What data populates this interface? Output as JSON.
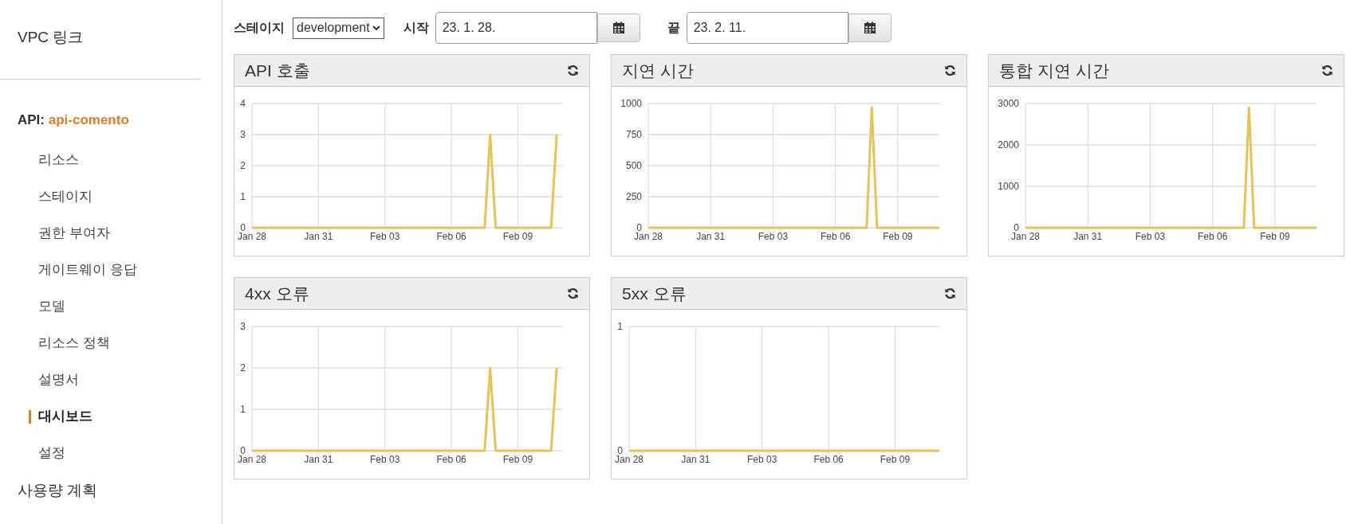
{
  "sidebar": {
    "top_link": "VPC 링크",
    "api_label": "API:",
    "api_name": "api-comento",
    "items": [
      {
        "label": "리소스",
        "selected": false
      },
      {
        "label": "스테이지",
        "selected": false
      },
      {
        "label": "권한 부여자",
        "selected": false
      },
      {
        "label": "게이트웨이 응답",
        "selected": false
      },
      {
        "label": "모델",
        "selected": false
      },
      {
        "label": "리소스 정책",
        "selected": false
      },
      {
        "label": "설명서",
        "selected": false
      },
      {
        "label": "대시보드",
        "selected": true
      },
      {
        "label": "설정",
        "selected": false
      }
    ],
    "bottom_link": "사용량 계획"
  },
  "controls": {
    "stage_label": "스테이지",
    "stage_value": "development",
    "start_label": "시작",
    "start_value": "23. 1. 28.",
    "end_label": "끝",
    "end_value": "23. 2. 11."
  },
  "panels": [
    {
      "title": "API 호출",
      "chart_data": {
        "type": "line",
        "grid": true,
        "ylim": [
          0,
          4
        ],
        "yticks": [
          0,
          1,
          2,
          3,
          4
        ],
        "categories": [
          "Jan 28",
          null,
          null,
          null,
          null,
          null,
          null,
          null,
          null,
          null,
          null,
          null,
          "Jan 31",
          null,
          null,
          null,
          null,
          null,
          null,
          null,
          null,
          null,
          null,
          null,
          "Feb 03",
          null,
          null,
          null,
          null,
          null,
          null,
          null,
          null,
          null,
          null,
          null,
          "Feb 06",
          null,
          null,
          null,
          null,
          null,
          null,
          null,
          null,
          null,
          null,
          null,
          "Feb 09",
          null,
          null,
          null,
          null,
          null,
          null,
          null,
          null
        ],
        "series": [
          {
            "color": "#e6c25a",
            "values": [
              0,
              0,
              0,
              0,
              0,
              0,
              0,
              0,
              0,
              0,
              0,
              0,
              0,
              0,
              0,
              0,
              0,
              0,
              0,
              0,
              0,
              0,
              0,
              0,
              0,
              0,
              0,
              0,
              0,
              0,
              0,
              0,
              0,
              0,
              0,
              0,
              0,
              0,
              0,
              0,
              0,
              0,
              0,
              3,
              0,
              0,
              0,
              0,
              0,
              0,
              0,
              0,
              0,
              0,
              0,
              3,
              null
            ]
          }
        ]
      }
    },
    {
      "title": "지연 시간",
      "chart_data": {
        "type": "line",
        "grid": true,
        "ylim": [
          0,
          1000
        ],
        "yticks": [
          0,
          250,
          500,
          750,
          1000
        ],
        "categories": [
          "Jan 28",
          null,
          null,
          null,
          null,
          null,
          null,
          null,
          null,
          null,
          null,
          null,
          "Jan 31",
          null,
          null,
          null,
          null,
          null,
          null,
          null,
          null,
          null,
          null,
          null,
          "Feb 03",
          null,
          null,
          null,
          null,
          null,
          null,
          null,
          null,
          null,
          null,
          null,
          "Feb 06",
          null,
          null,
          null,
          null,
          null,
          null,
          null,
          null,
          null,
          null,
          null,
          "Feb 09",
          null,
          null,
          null,
          null,
          null,
          null,
          null,
          null
        ],
        "series": [
          {
            "color": "#e6c25a",
            "values": [
              0,
              0,
              0,
              0,
              0,
              0,
              0,
              0,
              0,
              0,
              0,
              0,
              0,
              0,
              0,
              0,
              0,
              0,
              0,
              0,
              0,
              0,
              0,
              0,
              0,
              0,
              0,
              0,
              0,
              0,
              0,
              0,
              0,
              0,
              0,
              0,
              0,
              0,
              0,
              0,
              0,
              0,
              0,
              970,
              0,
              0,
              0,
              0,
              0,
              0,
              0,
              0,
              0,
              0,
              0,
              0,
              0
            ]
          }
        ]
      }
    },
    {
      "title": "통합 지연 시간",
      "chart_data": {
        "type": "line",
        "grid": true,
        "ylim": [
          0,
          3000
        ],
        "yticks": [
          0,
          1000,
          2000,
          3000
        ],
        "categories": [
          "Jan 28",
          null,
          null,
          null,
          null,
          null,
          null,
          null,
          null,
          null,
          null,
          null,
          "Jan 31",
          null,
          null,
          null,
          null,
          null,
          null,
          null,
          null,
          null,
          null,
          null,
          "Feb 03",
          null,
          null,
          null,
          null,
          null,
          null,
          null,
          null,
          null,
          null,
          null,
          "Feb 06",
          null,
          null,
          null,
          null,
          null,
          null,
          null,
          null,
          null,
          null,
          null,
          "Feb 09",
          null,
          null,
          null,
          null,
          null,
          null,
          null,
          null
        ],
        "series": [
          {
            "color": "#e6c25a",
            "values": [
              0,
              0,
              0,
              0,
              0,
              0,
              0,
              0,
              0,
              0,
              0,
              0,
              0,
              0,
              0,
              0,
              0,
              0,
              0,
              0,
              0,
              0,
              0,
              0,
              0,
              0,
              0,
              0,
              0,
              0,
              0,
              0,
              0,
              0,
              0,
              0,
              0,
              0,
              0,
              0,
              0,
              0,
              0,
              2900,
              0,
              0,
              0,
              0,
              0,
              0,
              0,
              0,
              0,
              0,
              0,
              0,
              0
            ]
          }
        ]
      }
    },
    {
      "title": "4xx 오류",
      "chart_data": {
        "type": "line",
        "grid": true,
        "ylim": [
          0,
          3
        ],
        "yticks": [
          0,
          1,
          2,
          3
        ],
        "categories": [
          "Jan 28",
          null,
          null,
          null,
          null,
          null,
          null,
          null,
          null,
          null,
          null,
          null,
          "Jan 31",
          null,
          null,
          null,
          null,
          null,
          null,
          null,
          null,
          null,
          null,
          null,
          "Feb 03",
          null,
          null,
          null,
          null,
          null,
          null,
          null,
          null,
          null,
          null,
          null,
          "Feb 06",
          null,
          null,
          null,
          null,
          null,
          null,
          null,
          null,
          null,
          null,
          null,
          "Feb 09",
          null,
          null,
          null,
          null,
          null,
          null,
          null,
          null
        ],
        "series": [
          {
            "color": "#e6c25a",
            "values": [
              0,
              0,
              0,
              0,
              0,
              0,
              0,
              0,
              0,
              0,
              0,
              0,
              0,
              0,
              0,
              0,
              0,
              0,
              0,
              0,
              0,
              0,
              0,
              0,
              0,
              0,
              0,
              0,
              0,
              0,
              0,
              0,
              0,
              0,
              0,
              0,
              0,
              0,
              0,
              0,
              0,
              0,
              0,
              2,
              0,
              0,
              0,
              0,
              0,
              0,
              0,
              0,
              0,
              0,
              0,
              2,
              null
            ]
          }
        ]
      }
    },
    {
      "title": "5xx 오류",
      "chart_data": {
        "type": "line",
        "grid": true,
        "ylim": [
          0,
          1
        ],
        "yticks": [
          0,
          1
        ],
        "categories": [
          "Jan 28",
          null,
          null,
          null,
          null,
          null,
          null,
          null,
          null,
          null,
          null,
          null,
          "Jan 31",
          null,
          null,
          null,
          null,
          null,
          null,
          null,
          null,
          null,
          null,
          null,
          "Feb 03",
          null,
          null,
          null,
          null,
          null,
          null,
          null,
          null,
          null,
          null,
          null,
          "Feb 06",
          null,
          null,
          null,
          null,
          null,
          null,
          null,
          null,
          null,
          null,
          null,
          "Feb 09",
          null,
          null,
          null,
          null,
          null,
          null,
          null,
          null
        ],
        "series": [
          {
            "color": "#e6c25a",
            "values": [
              0,
              0,
              0,
              0,
              0,
              0,
              0,
              0,
              0,
              0,
              0,
              0,
              0,
              0,
              0,
              0,
              0,
              0,
              0,
              0,
              0,
              0,
              0,
              0,
              0,
              0,
              0,
              0,
              0,
              0,
              0,
              0,
              0,
              0,
              0,
              0,
              0,
              0,
              0,
              0,
              0,
              0,
              0,
              0,
              0,
              0,
              0,
              0,
              0,
              0,
              0,
              0,
              0,
              0,
              0,
              0,
              0
            ]
          }
        ]
      }
    }
  ]
}
